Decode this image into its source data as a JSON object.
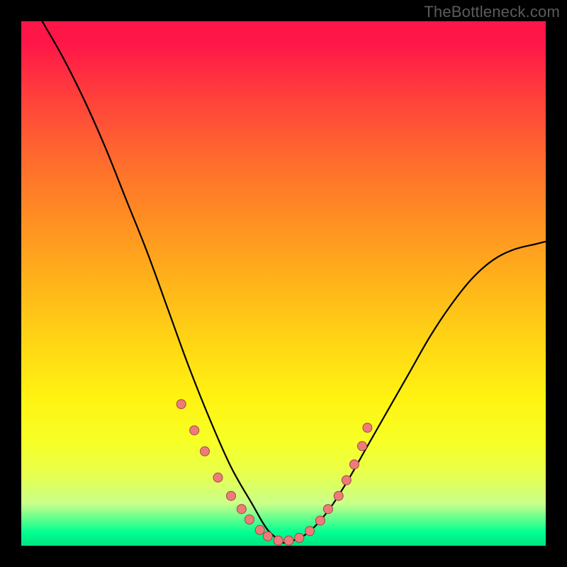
{
  "watermark": "TheBottleneck.com",
  "colors": {
    "dot_fill": "#ef7b79",
    "dot_stroke": "#9c4946",
    "curve": "#000000",
    "gradient_top": "#ff1648",
    "gradient_bottom": "#00e47f"
  },
  "chart_data": {
    "type": "line",
    "title": "",
    "xlabel": "",
    "ylabel": "",
    "xlim": [
      0,
      100
    ],
    "ylim": [
      0,
      100
    ],
    "note": "axes unlabeled; values estimated from pixel positions on a 0-100 normalized scale, y=0 at bottom",
    "series": [
      {
        "name": "left-branch",
        "x": [
          4,
          8,
          12,
          16,
          20,
          24,
          28,
          32,
          36,
          40,
          44,
          47,
          50
        ],
        "y": [
          100,
          93,
          85,
          76,
          66,
          56,
          45,
          34,
          24,
          15,
          8,
          3,
          0.5
        ]
      },
      {
        "name": "right-branch",
        "x": [
          50,
          54,
          58,
          62,
          66,
          70,
          74,
          78,
          82,
          86,
          90,
          94,
          98,
          100
        ],
        "y": [
          0.5,
          2,
          6,
          12,
          19,
          26,
          33,
          40,
          46,
          51,
          54.5,
          56.5,
          57.5,
          58
        ]
      }
    ],
    "points": {
      "name": "highlighted-dots",
      "x": [
        30.5,
        33.0,
        35.0,
        37.5,
        40.0,
        42.0,
        43.5,
        45.5,
        47.0,
        49.0,
        51.0,
        53.0,
        55.0,
        57.0,
        58.5,
        60.5,
        62.0,
        63.5,
        65.0,
        66.0
      ],
      "y": [
        27.0,
        22.0,
        18.0,
        13.0,
        9.5,
        7.0,
        5.0,
        3.0,
        1.8,
        1.0,
        1.0,
        1.5,
        2.8,
        4.8,
        7.0,
        9.5,
        12.5,
        15.5,
        19.0,
        22.5
      ]
    }
  }
}
